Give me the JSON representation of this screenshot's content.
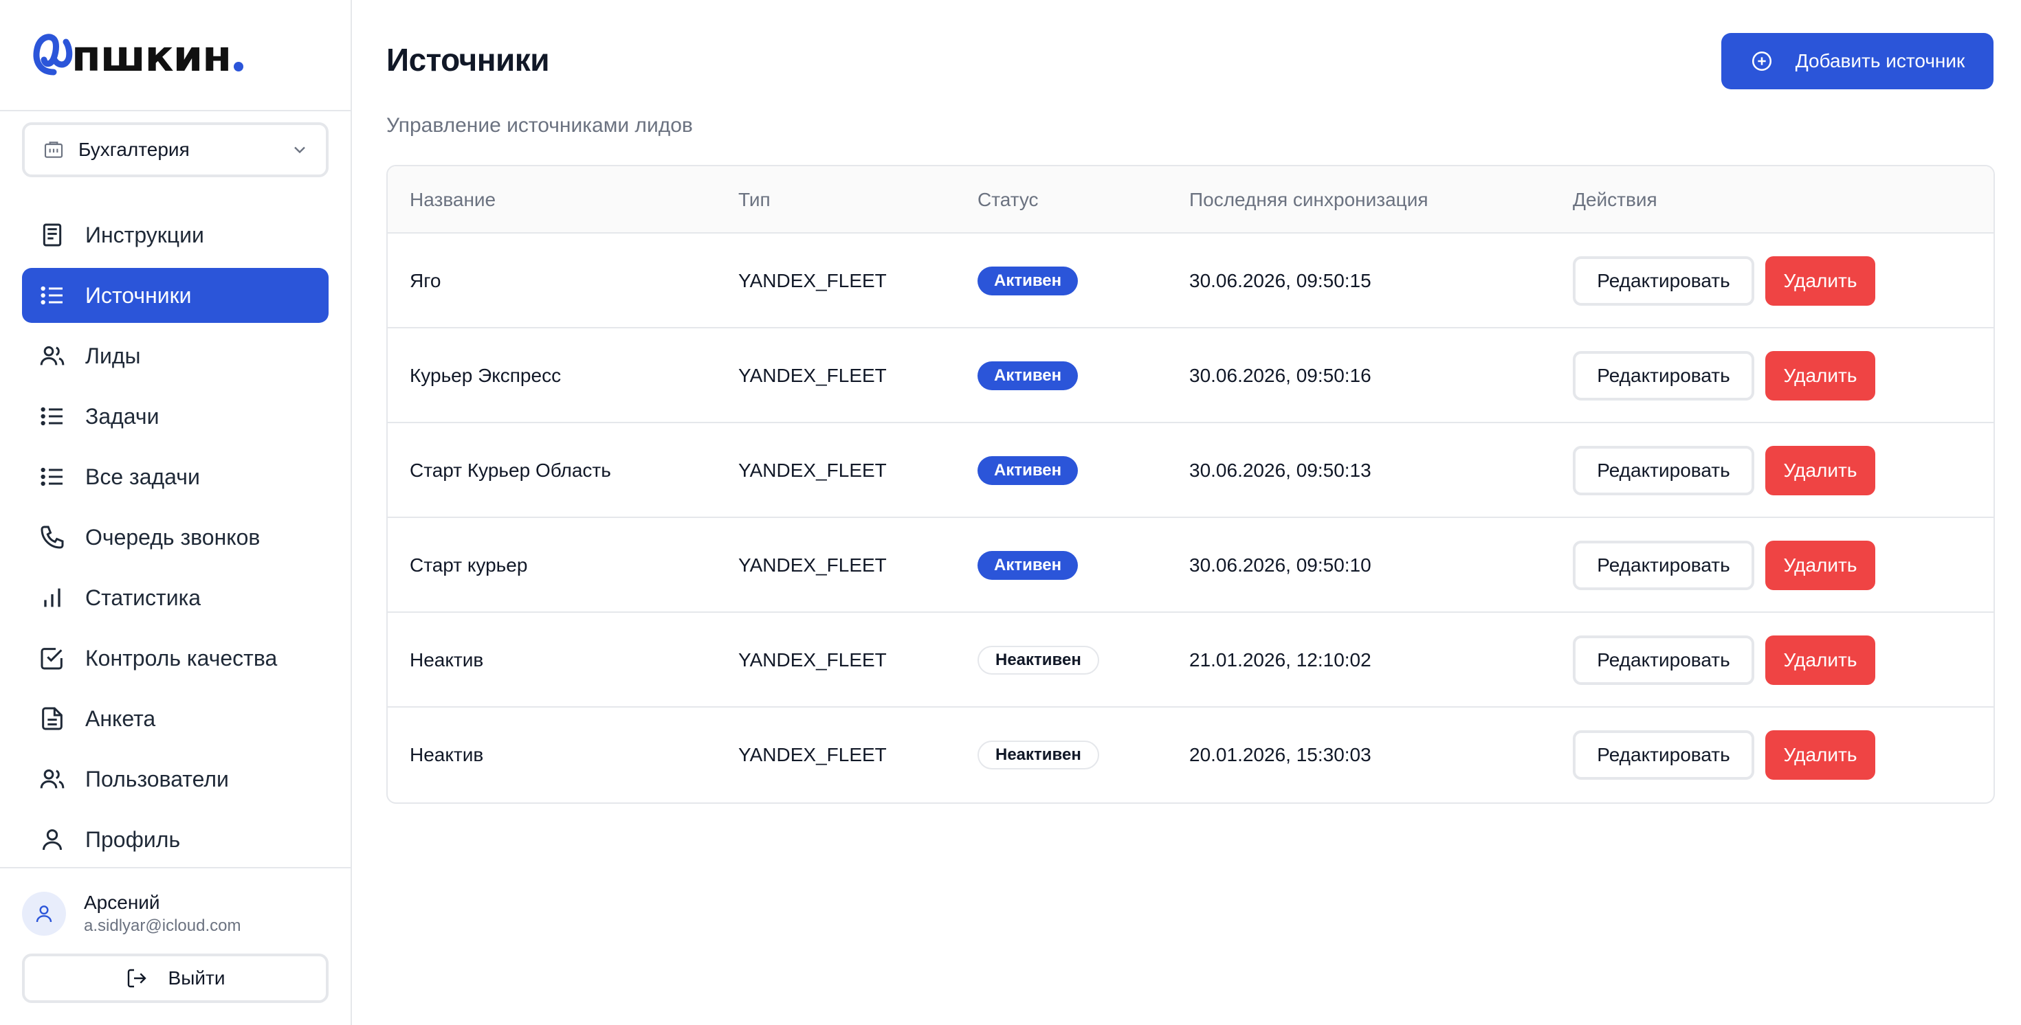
{
  "brand": {
    "text": "пшкин",
    "accent": "#2b55d9"
  },
  "org_select": {
    "value": "Бухгалтерия",
    "icon": "building-icon"
  },
  "nav": {
    "items": [
      {
        "label": "Инструкции",
        "icon": "book-icon"
      },
      {
        "label": "Источники",
        "icon": "list-icon",
        "active": true
      },
      {
        "label": "Лиды",
        "icon": "users-icon"
      },
      {
        "label": "Задачи",
        "icon": "list-icon"
      },
      {
        "label": "Все задачи",
        "icon": "list-icon"
      },
      {
        "label": "Очередь звонков",
        "icon": "phone-icon"
      },
      {
        "label": "Статистика",
        "icon": "bar-chart-icon"
      },
      {
        "label": "Контроль качества",
        "icon": "checkbox-icon"
      },
      {
        "label": "Анкета",
        "icon": "document-icon"
      },
      {
        "label": "Пользователи",
        "icon": "users-icon"
      },
      {
        "label": "Профиль",
        "icon": "user-icon"
      }
    ]
  },
  "user": {
    "name": "Арсений",
    "email": "a.sidlyar@icloud.com"
  },
  "logout": {
    "label": "Выйти"
  },
  "page": {
    "title": "Источники",
    "subtitle": "Управление источниками лидов",
    "add_label": "Добавить источник"
  },
  "table": {
    "columns": [
      "Название",
      "Тип",
      "Статус",
      "Последняя синхронизация",
      "Действия"
    ],
    "edit_label": "Редактировать",
    "delete_label": "Удалить",
    "rows": [
      {
        "name": "Яго",
        "type": "YANDEX_FLEET",
        "status": "Активен",
        "status_kind": "active",
        "sync": "30.06.2026, 09:50:15"
      },
      {
        "name": "Курьер Экспресс",
        "type": "YANDEX_FLEET",
        "status": "Активен",
        "status_kind": "active",
        "sync": "30.06.2026, 09:50:16"
      },
      {
        "name": "Старт Курьер Область",
        "type": "YANDEX_FLEET",
        "status": "Активен",
        "status_kind": "active",
        "sync": "30.06.2026, 09:50:13"
      },
      {
        "name": "Старт курьер",
        "type": "YANDEX_FLEET",
        "status": "Активен",
        "status_kind": "active",
        "sync": "30.06.2026, 09:50:10"
      },
      {
        "name": "Неактив",
        "type": "YANDEX_FLEET",
        "status": "Неактивен",
        "status_kind": "inactive",
        "sync": "21.01.2026, 12:10:02"
      },
      {
        "name": "Неактив",
        "type": "YANDEX_FLEET",
        "status": "Неактивен",
        "status_kind": "inactive",
        "sync": "20.01.2026, 15:30:03"
      }
    ]
  },
  "colors": {
    "primary": "#2b55d9",
    "danger": "#ef4444",
    "border": "#e5e7eb",
    "muted": "#6b7280"
  }
}
